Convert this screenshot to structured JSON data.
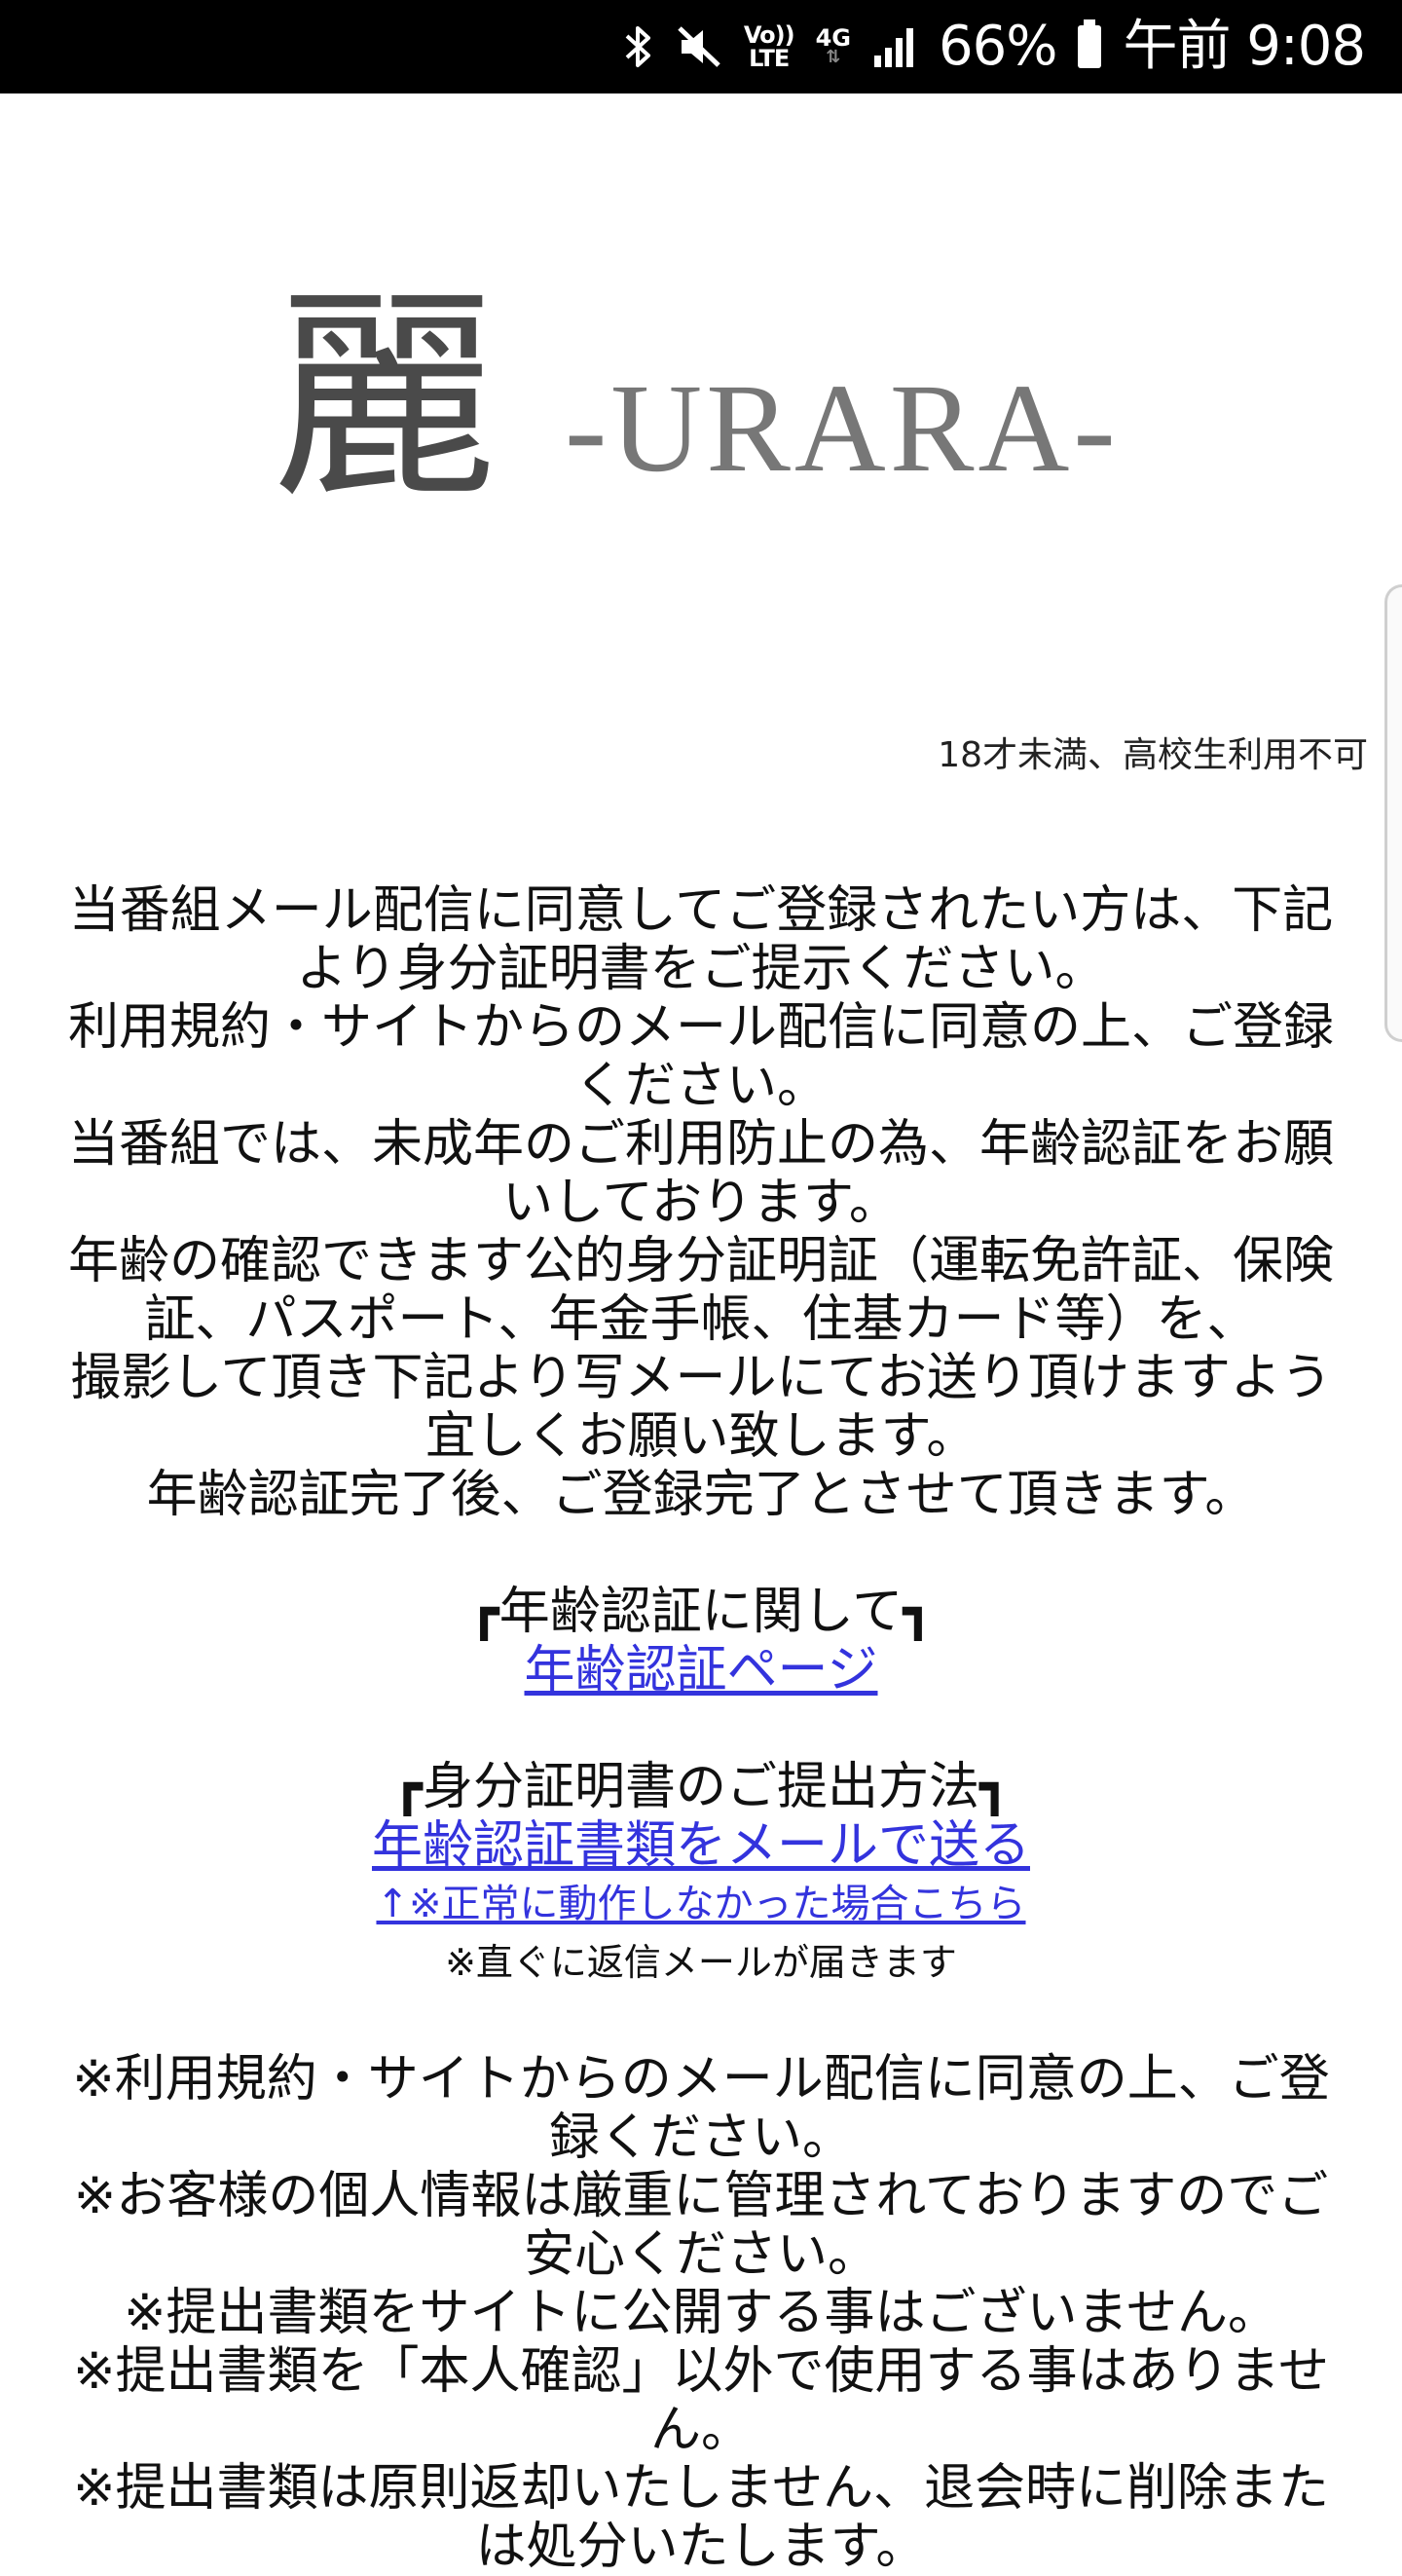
{
  "status_bar": {
    "icons": [
      "bluetooth-icon",
      "mute-icon",
      "volte-icon",
      "4g-icon",
      "signal-icon",
      "battery-icon"
    ],
    "volte_line1": "Vo))",
    "volte_line2": "LTE",
    "network": "4G",
    "battery": "66%",
    "time": "午前 9:08"
  },
  "logo": {
    "kanji": "麗",
    "roman": "-URARA-"
  },
  "age_notice": "18才未満、高校生利用不可",
  "intro": [
    "当番組メール配信に同意してご登録されたい方は、下記より身分証明書をご提示ください。",
    "利用規約・サイトからのメール配信に同意の上、ご登録ください。",
    "当番組では、未成年のご利用防止の為、年齢認証をお願いしております。",
    "年齢の確認できます公的身分証明証（運転免許証、保険証、パスポート、年金手帳、住基カード等）を、",
    "撮影して頂き下記より写メールにてお送り頂けますよう宜しくお願い致します。",
    "年齢認証完了後、ご登録完了とさせて頂きます。"
  ],
  "age_verify": {
    "heading": "┏年齢認証に関して┓",
    "link": "年齢認証ページ"
  },
  "submit": {
    "heading": "┏身分証明書のご提出方法┓",
    "link_main": "年齢認証書類をメールで送る",
    "link_alt": "↑※正常に動作しなかった場合こちら",
    "note": "※直ぐに返信メールが届きます"
  },
  "notes": [
    "※利用規約・サイトからのメール配信に同意の上、ご登録ください。",
    "※お客様の個人情報は厳重に管理されておりますのでご安心ください。",
    "※提出書類をサイトに公開する事はございません。",
    "※提出書類を「本人確認」以外で使用する事はありません。",
    "※提出書類は原則返却いたしません、退会時に削除または処分いたします。"
  ]
}
